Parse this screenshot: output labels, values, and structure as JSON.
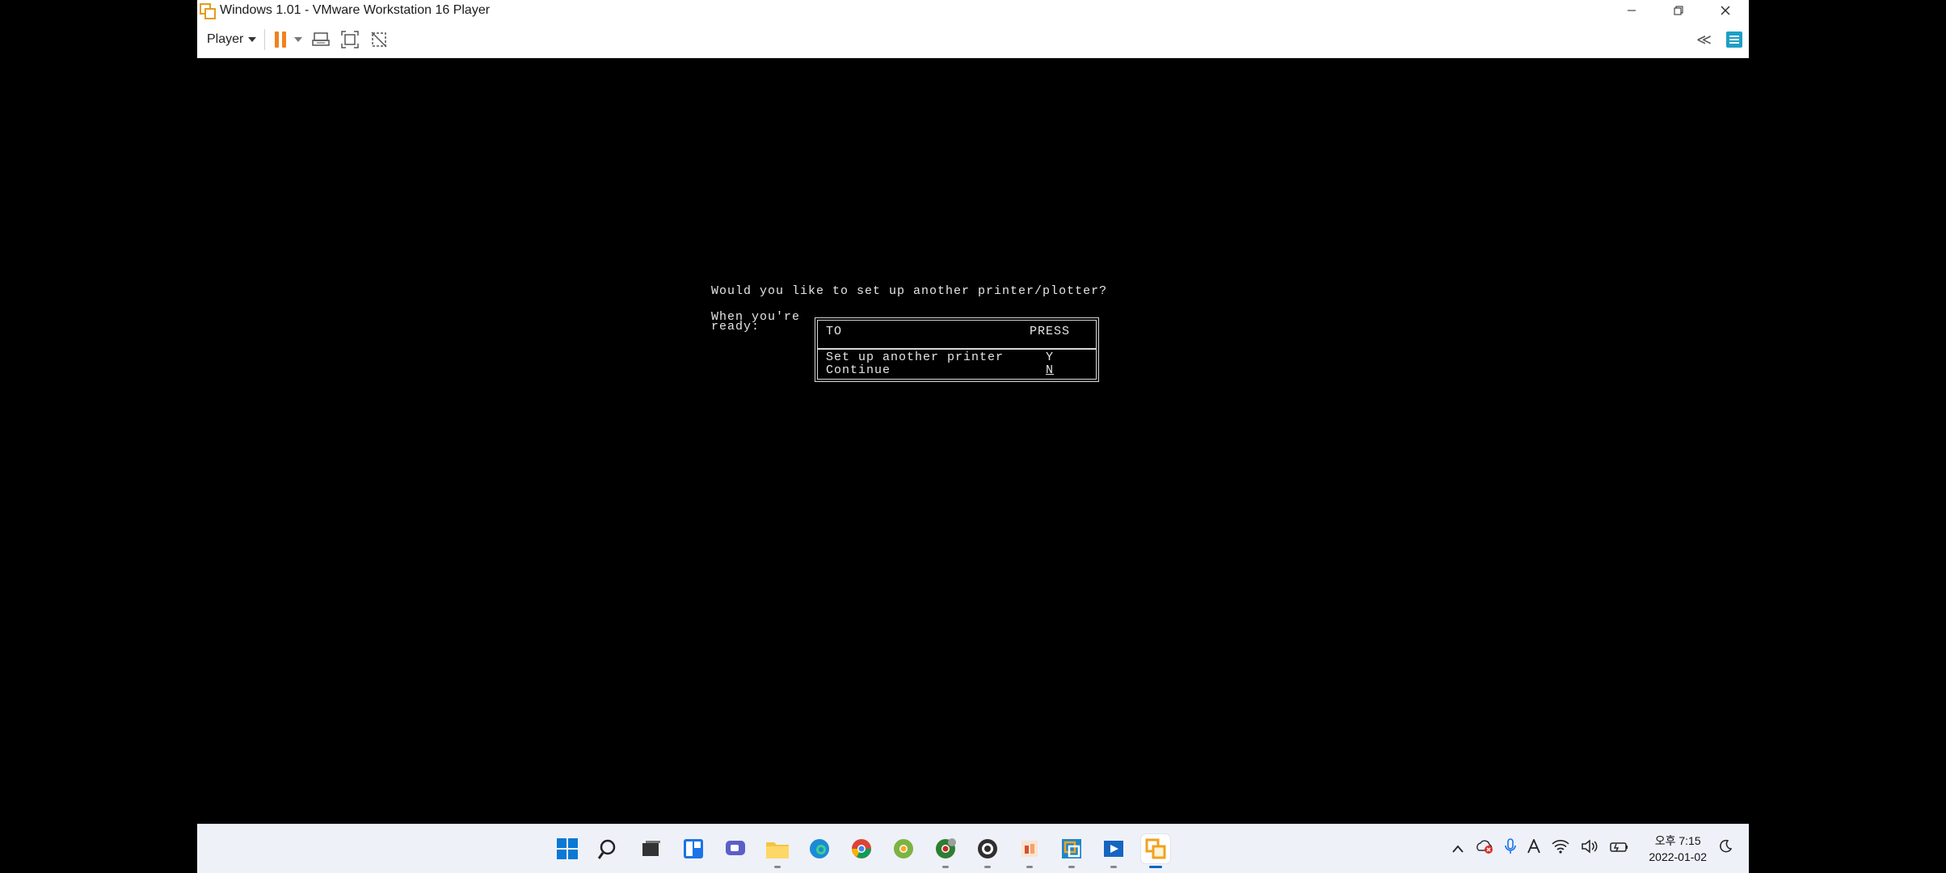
{
  "window": {
    "title": "Windows 1.01 - VMware Workstation 16 Player"
  },
  "toolbar": {
    "player_label": "Player",
    "collapse_glyph": "≪"
  },
  "vm": {
    "question": "Would you like to set up another printer/plotter?",
    "prompt_line1": "When you're",
    "prompt_line2": "ready:",
    "table": {
      "col_to": "TO",
      "col_press": "PRESS",
      "rows": [
        {
          "action": "Set up another printer",
          "key": "Y"
        },
        {
          "action": "Continue",
          "key": "N"
        }
      ]
    }
  },
  "taskbar": {
    "icons": [
      "windows-start-icon",
      "search-icon",
      "task-view-icon",
      "widgets-icon",
      "chat-icon",
      "file-explorer-icon",
      "edge-icon",
      "chrome-icon",
      "chrome-dev-icon",
      "chrome-canary-icon",
      "obs-icon",
      "office-icon",
      "vmware-workstation-icon",
      "media-player-icon",
      "vmware-player-icon"
    ]
  },
  "tray": {
    "time": "오후 7:15",
    "date": "2022-01-02"
  },
  "colors": {
    "pause_orange": "#f0821e",
    "library_teal": "#1d9fc5",
    "taskbar_bg": "#eef1f8"
  }
}
